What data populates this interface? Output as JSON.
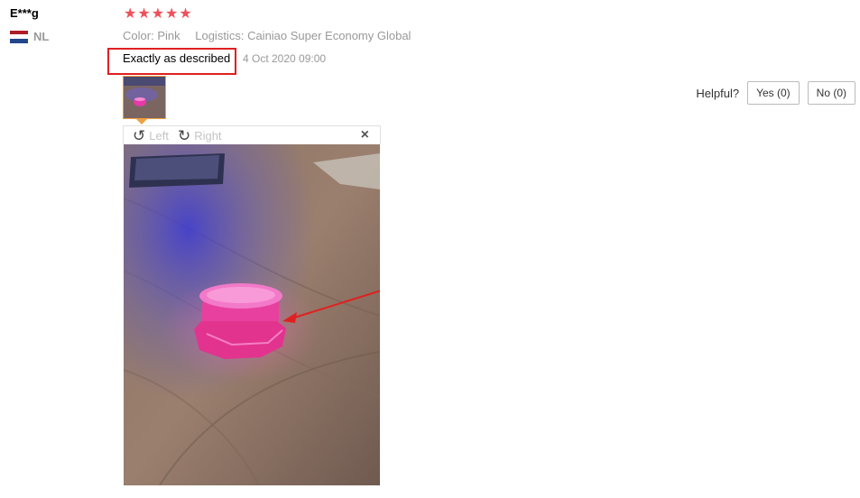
{
  "reviewer": {
    "name": "E***g",
    "country_code": "NL",
    "rating_stars": 5
  },
  "meta": {
    "color_key": "Color:",
    "color_value": "Pink",
    "logistics_key": "Logistics:",
    "logistics_value": "Cainiao Super Economy Global"
  },
  "feedback": {
    "text": "Exactly as described",
    "date": "4 Oct 2020 09:00"
  },
  "helpful": {
    "label": "Helpful?",
    "yes_label": "Yes (0)",
    "no_label": "No (0)"
  },
  "viewer": {
    "rotate_left_label": "Left",
    "rotate_right_label": "Right",
    "close_label": "×"
  },
  "colors": {
    "star": "#f0505a",
    "highlight_box": "#e02020",
    "thumb_border": "#f0a040"
  },
  "icons": {
    "rotate_left": "rotate-left-icon",
    "rotate_right": "rotate-right-icon",
    "close": "close-icon",
    "star": "star-icon",
    "flag": "netherlands-flag-icon"
  }
}
